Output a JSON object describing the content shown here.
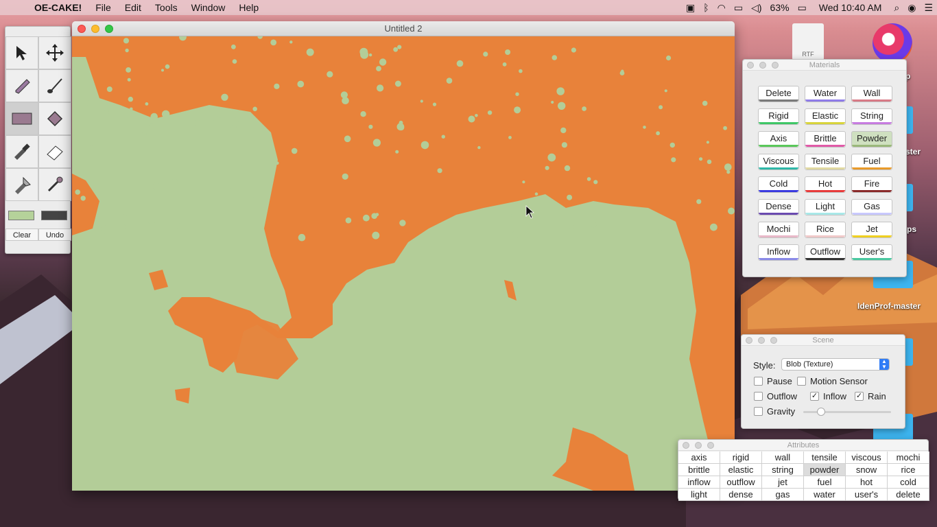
{
  "menubar": {
    "app_name": "OE-CAKE!",
    "menus": [
      "File",
      "Edit",
      "Tools",
      "Window",
      "Help"
    ],
    "battery": "63%",
    "clock": "Wed 10:40 AM"
  },
  "desktop": {
    "labels": [
      "ster",
      "ps",
      "IdenProf-master",
      "p"
    ],
    "file_ext": "RTF"
  },
  "tools_palette": {
    "tools": [
      "select-arrow-icon",
      "move-icon",
      "pencil-icon",
      "brush-icon",
      "rectangle-icon",
      "paint-bucket-icon",
      "knife-icon",
      "eraser-icon",
      "flashlight-icon",
      "eyedropper-icon"
    ],
    "swatch_colors": [
      "#b5d29a",
      "#444444"
    ],
    "clear_label": "Clear",
    "undo_label": "Undo"
  },
  "main_window": {
    "title": "Untitled 2",
    "fluid_color": "#e8823a",
    "ground_color": "#b3cd98"
  },
  "materials_panel": {
    "title": "Materials",
    "buttons": [
      {
        "label": "Delete",
        "color": "#7a7a7a"
      },
      {
        "label": "Water",
        "color": "#8e7be8"
      },
      {
        "label": "Wall",
        "color": "#d87a86"
      },
      {
        "label": "Rigid",
        "color": "#3ec766"
      },
      {
        "label": "Elastic",
        "color": "#d8d43a"
      },
      {
        "label": "String",
        "color": "#c77be0"
      },
      {
        "label": "Axis",
        "color": "#5ac85a"
      },
      {
        "label": "Brittle",
        "color": "#e05aa8"
      },
      {
        "label": "Powder",
        "color": "#9ab87a"
      },
      {
        "label": "Viscous",
        "color": "#2fb8a8"
      },
      {
        "label": "Tensile",
        "color": "#e0d8a0"
      },
      {
        "label": "Fuel",
        "color": "#e89a2a"
      },
      {
        "label": "Cold",
        "color": "#3a3ae0"
      },
      {
        "label": "Hot",
        "color": "#e83a3a"
      },
      {
        "label": "Fire",
        "color": "#8a2a2a"
      },
      {
        "label": "Dense",
        "color": "#6a4ab0"
      },
      {
        "label": "Light",
        "color": "#a8e8e8"
      },
      {
        "label": "Gas",
        "color": "#c8c8ff"
      },
      {
        "label": "Mochi",
        "color": "#e8b8c8"
      },
      {
        "label": "Rice",
        "color": "#f0c8c8"
      },
      {
        "label": "Jet",
        "color": "#f0d020"
      },
      {
        "label": "Inflow",
        "color": "#8a8ae8"
      },
      {
        "label": "Outflow",
        "color": "#333333"
      },
      {
        "label": "User's",
        "color": "#4ac8a0"
      }
    ],
    "selected": "Powder"
  },
  "scene_panel": {
    "title": "Scene",
    "style_label": "Style:",
    "style_value": "Blob (Texture)",
    "pause_label": "Pause",
    "motion_label": "Motion Sensor",
    "outflow_label": "Outflow",
    "inflow_label": "Inflow",
    "rain_label": "Rain",
    "gravity_label": "Gravity",
    "pause_checked": false,
    "motion_checked": false,
    "outflow_checked": false,
    "inflow_checked": true,
    "rain_checked": true,
    "gravity_checked": false,
    "gravity_level": 0.2,
    "check_mark": "✓"
  },
  "attributes_panel": {
    "title": "Attributes",
    "cells": [
      "axis",
      "rigid",
      "wall",
      "tensile",
      "viscous",
      "mochi",
      "brittle",
      "elastic",
      "string",
      "powder",
      "snow",
      "rice",
      "inflow",
      "outflow",
      "jet",
      "fuel",
      "hot",
      "cold",
      "light",
      "dense",
      "gas",
      "water",
      "user's",
      "delete"
    ],
    "selected": "powder"
  }
}
